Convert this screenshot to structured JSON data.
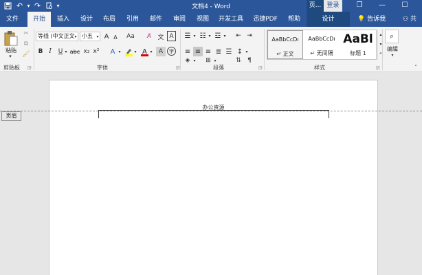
{
  "window": {
    "title": "文档4 - Word",
    "context_title": "页...",
    "login_label": "登录",
    "controls": [
      "❐",
      "—",
      "☐"
    ]
  },
  "quick_access": [
    "save-icon",
    "undo-icon",
    "redo-icon",
    "print-preview-icon"
  ],
  "tabs": {
    "file": "文件",
    "home": "开始",
    "insert": "插入",
    "design": "设计",
    "layout": "布局",
    "references": "引用",
    "mailings": "邮件",
    "review": "审阅",
    "view": "视图",
    "developer": "开发工具",
    "pdf": "迅捷PDF",
    "help": "帮助",
    "ctx_design": "设计",
    "tell_me": "告诉我",
    "share": "共享"
  },
  "ribbon": {
    "clipboard": {
      "paste": "粘贴",
      "label": "剪贴板"
    },
    "font": {
      "font_name": "等线 (中文正文",
      "font_size": "小五",
      "grow": "A",
      "shrink": "A",
      "case": "Aa",
      "bold": "B",
      "italic": "I",
      "underline": "U",
      "strike": "abc",
      "subscript": "x₂",
      "superscript": "x²",
      "label": "字体"
    },
    "paragraph": {
      "label": "段落"
    },
    "styles": {
      "items": [
        {
          "sample": "AaBbCcDı",
          "name": "↵ 正文"
        },
        {
          "sample": "AaBbCcDı",
          "name": "↵ 无间隔"
        },
        {
          "sample": "AaBl",
          "name": "标题 1"
        }
      ],
      "label": "样式"
    },
    "editing": {
      "label": "编辑"
    }
  },
  "document": {
    "header_text": "办公资源",
    "header_tag": "页眉"
  },
  "colors": {
    "brand": "#2b579a",
    "ribbon": "#f3f3f3",
    "canvas": "#e6e6e6",
    "highlight": "#ffff00",
    "font_color": "#e00000"
  }
}
